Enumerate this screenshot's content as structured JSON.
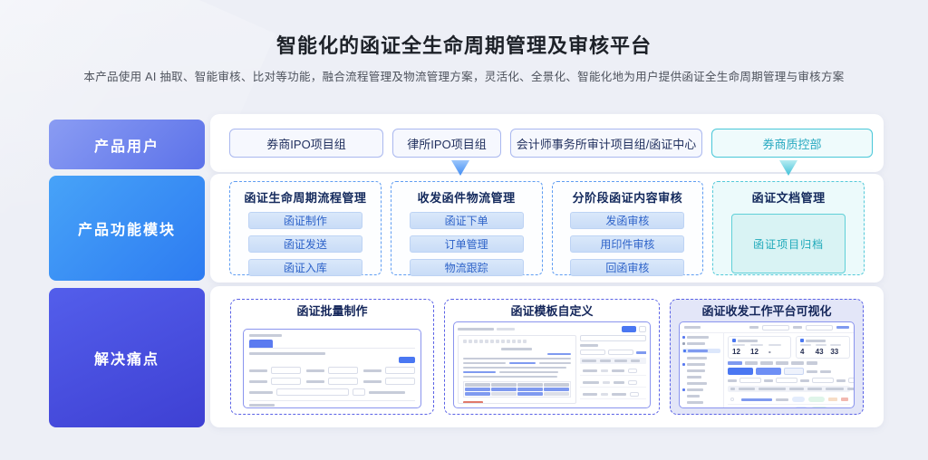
{
  "header": {
    "title": "智能化的函证全生命周期管理及审核平台",
    "subtitle": "本产品使用 AI 抽取、智能审核、比对等功能，融合流程管理及物流管理方案，灵活化、全景化、智能化地为用户提供函证全生命周期管理与审核方案"
  },
  "rows": {
    "users": {
      "label": "产品用户",
      "items": [
        {
          "label": "券商IPO项目组",
          "variant": "blue"
        },
        {
          "label": "律所IPO项目组",
          "variant": "blue"
        },
        {
          "label": "会计师事务所审计项目组/函证中心",
          "variant": "blue"
        },
        {
          "label": "券商质控部",
          "variant": "teal"
        }
      ]
    },
    "modules": {
      "label": "产品功能模块",
      "groups": [
        {
          "title": "函证生命周期流程管理",
          "variant": "blue",
          "items": [
            "函证制作",
            "函证发送",
            "函证入库"
          ]
        },
        {
          "title": "收发函件物流管理",
          "variant": "blue",
          "items": [
            "函证下单",
            "订单管理",
            "物流跟踪"
          ]
        },
        {
          "title": "分阶段函证内容审核",
          "variant": "blue",
          "items": [
            "发函审核",
            "用印件审核",
            "回函审核"
          ]
        },
        {
          "title": "函证文档管理",
          "variant": "teal",
          "items": [
            "函证项目归档"
          ]
        }
      ]
    },
    "pain": {
      "label": "解决痛点",
      "cards": [
        {
          "title": "函证批量制作"
        },
        {
          "title": "函证模板自定义"
        },
        {
          "title": "函证收发工作平台可视化",
          "stats": {
            "left": {
              "values": [
                "12",
                "12",
                "-"
              ]
            },
            "right": {
              "values": [
                "4",
                "43",
                "33"
              ]
            }
          }
        }
      ]
    }
  },
  "colors": {
    "page_bg": "#edeff6",
    "panel_bg": "#ffffff",
    "accent_periwinkle": "#6f82ee",
    "accent_blue": "#2f7ef2",
    "accent_indigo": "#4549dd",
    "accent_teal": "#3fc3d6",
    "chip_text_navy": "#22315f",
    "chip_border_blue": "#aab8ef",
    "teal_chip_text": "#27a9c0",
    "module_title_navy": "#13295c",
    "module_button_bg": "#cfe0f8",
    "module_button_text": "#2e63c9",
    "archive_box_bg": "#d9f3f4",
    "archive_text_teal": "#1fa9ba",
    "card_dashed_border": "#5a62e6",
    "card3_bg": "#e3e6f8",
    "arrow_blue": "#3f8cf4",
    "arrow_teal": "#3ec0d8"
  }
}
